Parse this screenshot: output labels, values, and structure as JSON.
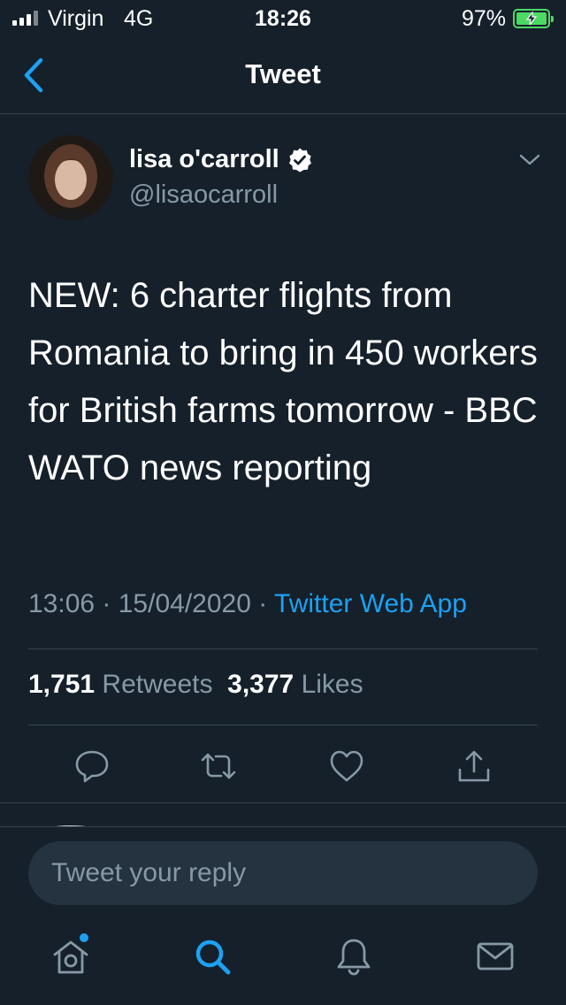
{
  "status_bar": {
    "carrier": "Virgin",
    "network": "4G",
    "time": "18:26",
    "battery": "97%"
  },
  "header": {
    "title": "Tweet"
  },
  "tweet": {
    "author_name": "lisa o'carroll",
    "author_handle": "@lisaocarroll",
    "text": "NEW: 6 charter flights from Romania to bring in 450 workers for British farms tomorrow - BBC WATO news reporting",
    "time": "13:06",
    "date": "15/04/2020",
    "source": "Twitter Web App",
    "retweets_count": "1,751",
    "retweets_label": "Retweets",
    "likes_count": "3,377",
    "likes_label": "Likes"
  },
  "reply": {
    "placeholder": "Tweet your reply"
  },
  "colors": {
    "background": "#15202b",
    "accent": "#1da1f2",
    "secondary_text": "#8899a6",
    "divider": "#38444d"
  },
  "icons": {
    "actions": [
      "reply-icon",
      "retweet-icon",
      "like-icon",
      "share-icon"
    ],
    "tabs": [
      "home-icon",
      "search-icon",
      "notifications-icon",
      "messages-icon"
    ]
  }
}
